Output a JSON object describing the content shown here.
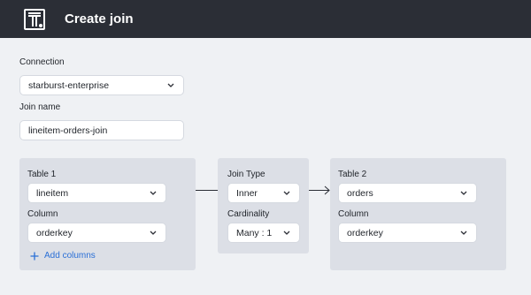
{
  "header": {
    "title": "Create join"
  },
  "connection": {
    "label": "Connection",
    "value": "starburst-enterprise"
  },
  "join_name": {
    "label": "Join name",
    "value": "lineitem-orders-join"
  },
  "table1": {
    "title": "Table 1",
    "table_value": "lineitem",
    "column_label": "Column",
    "column_value": "orderkey",
    "add_columns_label": "Add columns"
  },
  "join": {
    "type_label": "Join Type",
    "type_value": "Inner",
    "cardinality_label": "Cardinality",
    "cardinality_value": "Many : 1"
  },
  "table2": {
    "title": "Table 2",
    "table_value": "orders",
    "column_label": "Column",
    "column_value": "orderkey"
  },
  "icons": {
    "logo": "logo-icon",
    "dropdown": "chevron-down-icon",
    "add": "plus-icon",
    "arrow": "arrow-right-icon"
  },
  "colors": {
    "topbar": "#2b2e36",
    "accent": "#2a6fd6",
    "panel": "#dcdfe6"
  }
}
